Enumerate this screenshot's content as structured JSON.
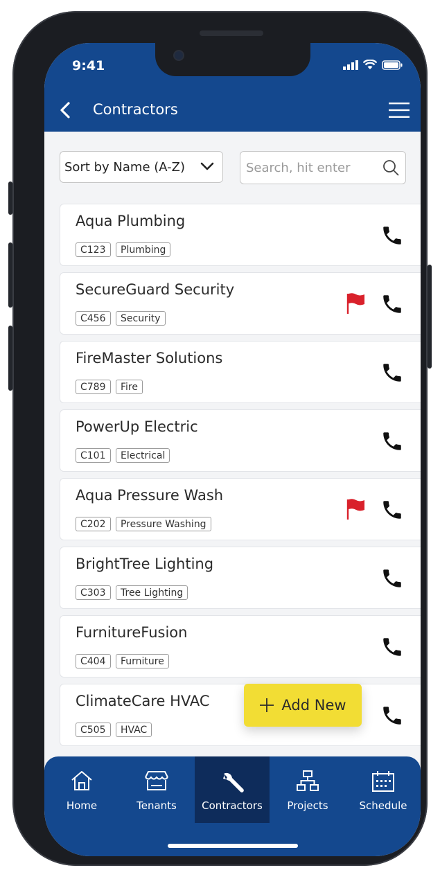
{
  "status_bar": {
    "time": "9:41"
  },
  "header": {
    "title": "Contractors"
  },
  "controls": {
    "sort_label": "Sort by Name (A-Z)",
    "search_placeholder": "Search, hit enter"
  },
  "contractors": [
    {
      "name": "Aqua Plumbing",
      "code": "C123",
      "category": "Plumbing",
      "flagged": false
    },
    {
      "name": "SecureGuard Security",
      "code": "C456",
      "category": "Security",
      "flagged": true
    },
    {
      "name": "FireMaster Solutions",
      "code": "C789",
      "category": "Fire",
      "flagged": false
    },
    {
      "name": "PowerUp Electric",
      "code": "C101",
      "category": "Electrical",
      "flagged": false
    },
    {
      "name": "Aqua Pressure Wash",
      "code": "C202",
      "category": "Pressure Washing",
      "flagged": true
    },
    {
      "name": "BrightTree Lighting",
      "code": "C303",
      "category": "Tree Lighting",
      "flagged": false
    },
    {
      "name": "FurnitureFusion",
      "code": "C404",
      "category": "Furniture",
      "flagged": false
    },
    {
      "name": "ClimateCare HVAC",
      "code": "C505",
      "category": "HVAC",
      "flagged": false
    }
  ],
  "fab": {
    "label": "Add New"
  },
  "nav": {
    "items": [
      {
        "label": "Home",
        "icon": "home-icon"
      },
      {
        "label": "Tenants",
        "icon": "storefront-icon"
      },
      {
        "label": "Contractors",
        "icon": "wrench-icon",
        "active": true
      },
      {
        "label": "Projects",
        "icon": "org-chart-icon"
      },
      {
        "label": "Schedule",
        "icon": "calendar-icon"
      }
    ]
  },
  "colors": {
    "header": "#14488e",
    "active_nav": "#0e2c5b",
    "fab": "#f2dd34",
    "flag": "#d9212b"
  }
}
